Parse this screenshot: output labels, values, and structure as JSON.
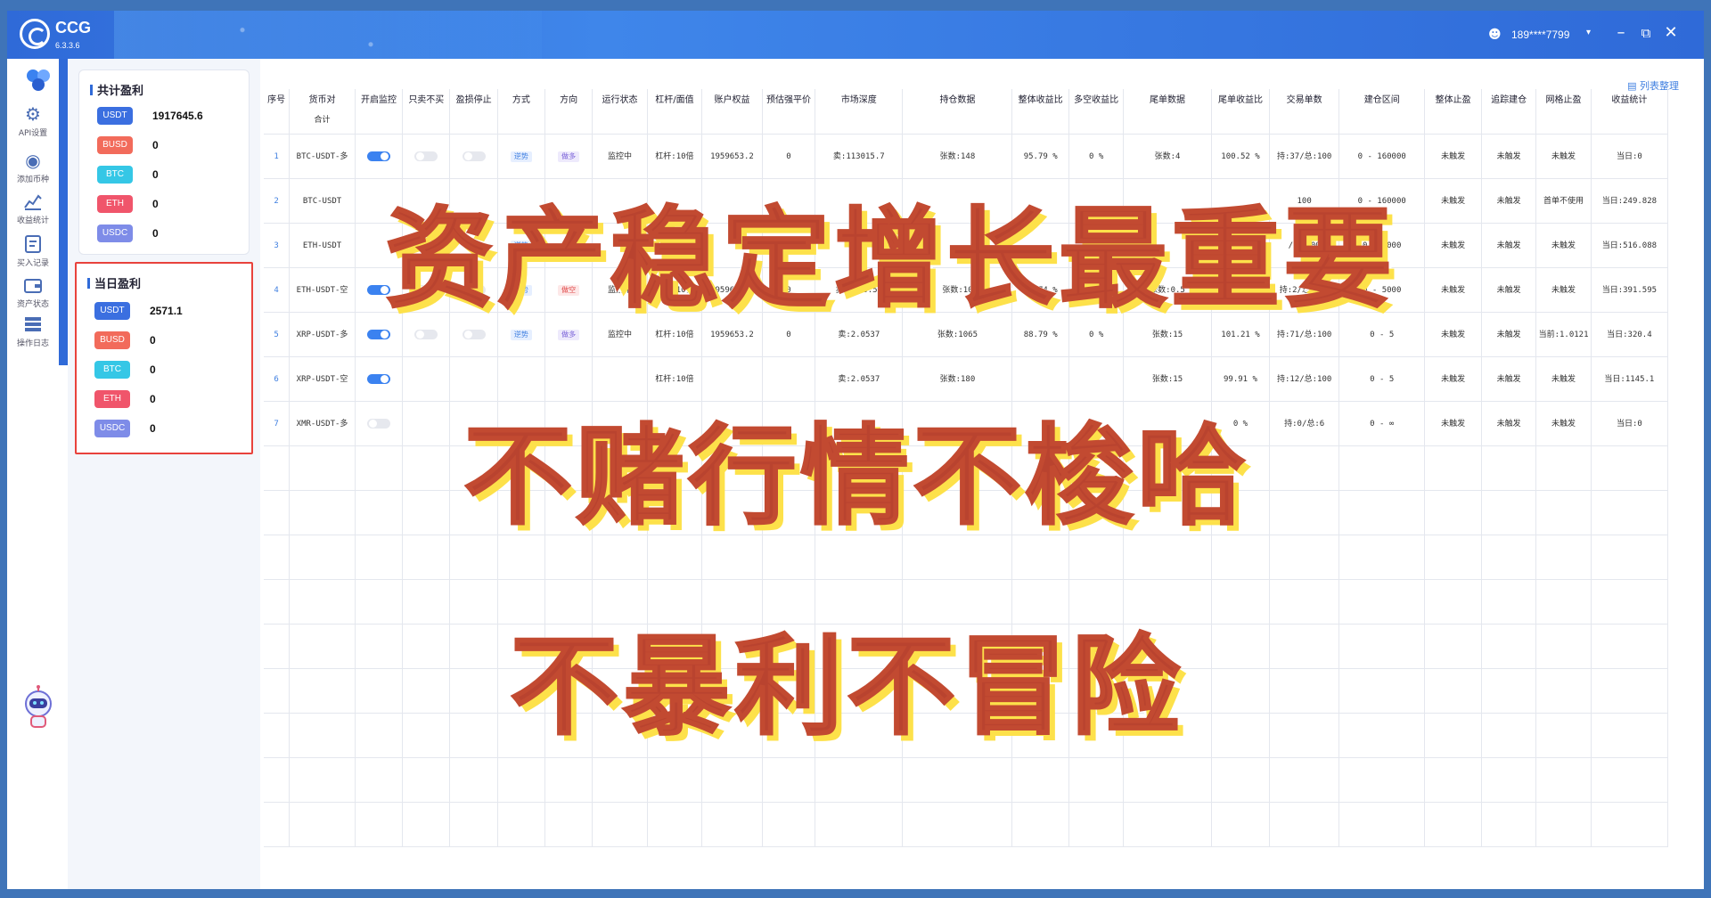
{
  "app": {
    "name": "CCG",
    "version": "6.3.3.6"
  },
  "user": {
    "name": "189****7799"
  },
  "sidebar": {
    "items": [
      {
        "label": "API设置",
        "icon": "gear-icon"
      },
      {
        "label": "添加币种",
        "icon": "coin-add-icon"
      },
      {
        "label": "收益统计",
        "icon": "chart-icon"
      },
      {
        "label": "买入记录",
        "icon": "record-icon"
      },
      {
        "label": "资产状态",
        "icon": "wallet-icon"
      },
      {
        "label": "操作日志",
        "icon": "log-icon"
      }
    ]
  },
  "summary": {
    "total": {
      "title": "共计盈利",
      "rows": [
        {
          "currency": "USDT",
          "value": "1917645.6",
          "color": "#3b6fe0"
        },
        {
          "currency": "BUSD",
          "value": "0",
          "color": "#f26b5b"
        },
        {
          "currency": "BTC",
          "value": "0",
          "color": "#35c7e6"
        },
        {
          "currency": "ETH",
          "value": "0",
          "color": "#f0556b"
        },
        {
          "currency": "USDC",
          "value": "0",
          "color": "#7e8ce8"
        }
      ]
    },
    "today": {
      "title": "当日盈利",
      "rows": [
        {
          "currency": "USDT",
          "value": "2571.1",
          "color": "#3b6fe0"
        },
        {
          "currency": "BUSD",
          "value": "0",
          "color": "#f26b5b"
        },
        {
          "currency": "BTC",
          "value": "0",
          "color": "#35c7e6"
        },
        {
          "currency": "ETH",
          "value": "0",
          "color": "#f0556b"
        },
        {
          "currency": "USDC",
          "value": "0",
          "color": "#7e8ce8"
        }
      ]
    }
  },
  "table": {
    "manage_label": "列表整理",
    "sum_label": "合计",
    "headers": [
      "序号",
      "货币对",
      "开启监控",
      "只卖不买",
      "盈损停止",
      "方式",
      "方向",
      "运行状态",
      "杠杆/面值",
      "账户权益",
      "预估强平价",
      "市场深度",
      "持仓数据",
      "整体收益比",
      "多空收益比",
      "尾单数据",
      "尾单收益比",
      "交易单数",
      "建仓区间",
      "整体止盈",
      "追踪建仓",
      "网格止盈",
      "收益统计"
    ],
    "rows": [
      {
        "idx": "1",
        "pair": "BTC-USDT-多",
        "mon": "on",
        "sell": "off",
        "stop": "off",
        "mode": "逆势",
        "dir": "做多",
        "dirc": "purple",
        "status": "监控中",
        "lev": "杠杆:10倍",
        "equity": "1959653.2",
        "liq": "0",
        "depth": "卖:113015.7",
        "pos": "张数:148",
        "ratio": "95.79 %",
        "ls": "0 %",
        "tail": "张数:4",
        "tailr": "100.52 %",
        "count": "持:37/总:100",
        "range": "0 - 160000",
        "tp": "未触发",
        "track": "未触发",
        "grid": "未触发",
        "stat": "当日:0"
      },
      {
        "idx": "2",
        "pair": "BTC-USDT",
        "mon": "",
        "sell": "",
        "stop": "",
        "mode": "",
        "dir": "",
        "dirc": "",
        "status": "",
        "lev": "",
        "equity": "",
        "liq": "",
        "depth": "",
        "pos": "",
        "ratio": "",
        "ls": "",
        "tail": "",
        "tailr": "",
        "count": "100",
        "range": "0 - 160000",
        "tp": "未触发",
        "track": "未触发",
        "grid": "首单不使用",
        "stat": "当日:249.828"
      },
      {
        "idx": "3",
        "pair": "ETH-USDT",
        "mon": "",
        "sell": "off",
        "stop": "",
        "mode": "逆势",
        "dir": "",
        "dirc": "",
        "status": "",
        "lev": "",
        "equity": "",
        "liq": "",
        "depth": "",
        "pos": "",
        "ratio": "",
        "ls": "",
        "tail": "",
        "tailr": "",
        "count": "/总:100",
        "range": "0 - 5000",
        "tp": "未触发",
        "track": "未触发",
        "grid": "未触发",
        "stat": "当日:516.088"
      },
      {
        "idx": "4",
        "pair": "ETH-USDT-空",
        "mon": "on",
        "sell": "off",
        "stop": "off",
        "mode": "逆势",
        "dir": "做空",
        "dirc": "red",
        "status": "监控中",
        "lev": "杠杆:10倍",
        "equity": "1959653.2",
        "liq": "0",
        "depth": "卖:4150.54",
        "pos": "张数:10",
        "ratio": "99.74 %",
        "ls": "0 %",
        "tail": "张数:0.5",
        "tailr": "99.9 %",
        "count": "持:2/总:100",
        "range": "0 - 5000",
        "tp": "未触发",
        "track": "未触发",
        "grid": "未触发",
        "stat": "当日:391.595"
      },
      {
        "idx": "5",
        "pair": "XRP-USDT-多",
        "mon": "on",
        "sell": "off",
        "stop": "off",
        "mode": "逆势",
        "dir": "做多",
        "dirc": "purple",
        "status": "监控中",
        "lev": "杠杆:10倍",
        "equity": "1959653.2",
        "liq": "0",
        "depth": "卖:2.0537",
        "pos": "张数:1065",
        "ratio": "88.79 %",
        "ls": "0 %",
        "tail": "张数:15",
        "tailr": "101.21 %",
        "count": "持:71/总:100",
        "range": "0 - 5",
        "tp": "未触发",
        "track": "未触发",
        "grid": "当前:1.0121",
        "stat": "当日:320.4"
      },
      {
        "idx": "6",
        "pair": "XRP-USDT-空",
        "mon": "on",
        "sell": "",
        "stop": "",
        "mode": "",
        "dir": "",
        "dirc": "",
        "status": "",
        "lev": "杠杆:10倍",
        "equity": "",
        "liq": "",
        "depth": "卖:2.0537",
        "pos": "张数:180",
        "ratio": "",
        "ls": "",
        "tail": "张数:15",
        "tailr": "99.91 %",
        "count": "持:12/总:100",
        "range": "0 - 5",
        "tp": "未触发",
        "track": "未触发",
        "grid": "未触发",
        "stat": "当日:1145.1"
      },
      {
        "idx": "7",
        "pair": "XMR-USDT-多",
        "mon": "off",
        "sell": "",
        "stop": "",
        "mode": "",
        "dir": "",
        "dirc": "",
        "status": "",
        "lev": "",
        "equity": "",
        "liq": "",
        "depth": "",
        "pos": "",
        "ratio": "",
        "ls": "",
        "tail": "",
        "tailr": "0 %",
        "count": "持:0/总:6",
        "range": "0 - ∞",
        "tp": "未触发",
        "track": "未触发",
        "grid": "未触发",
        "stat": "当日:0"
      }
    ]
  },
  "overlay": {
    "line1": "资产稳定增长最重要",
    "line2": "不赌行情不梭哈",
    "line3": "不暴利不冒险"
  },
  "colors": {
    "title_bar": "#2f6ad8",
    "highlight_border": "#e8423c",
    "overlay_text": "#b9432f",
    "overlay_shadow": "#fde14a"
  }
}
